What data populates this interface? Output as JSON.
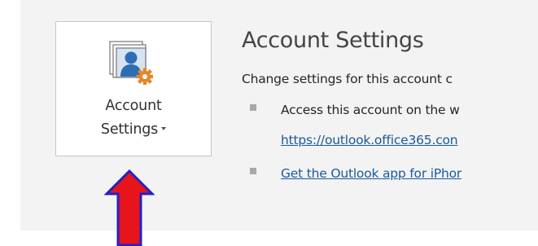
{
  "account_settings_button": {
    "label_line1": "Account",
    "label_line2": "Settings",
    "icon": "account-settings-icon"
  },
  "section": {
    "title": "Account Settings",
    "description": "Change settings for this account c",
    "items": [
      {
        "text": "Access this account on the w",
        "link": "https://outlook.office365.con"
      },
      {
        "link": "Get the Outlook app for iPhor"
      }
    ]
  },
  "annotation": {
    "arrow_icon": "red-up-arrow-icon",
    "arrow_color": "#e8141b"
  },
  "colors": {
    "link": "#1a5a9c",
    "panel_background": "#f3f3f3",
    "icon_blue": "#2e6db4",
    "icon_orange": "#e5862a"
  }
}
